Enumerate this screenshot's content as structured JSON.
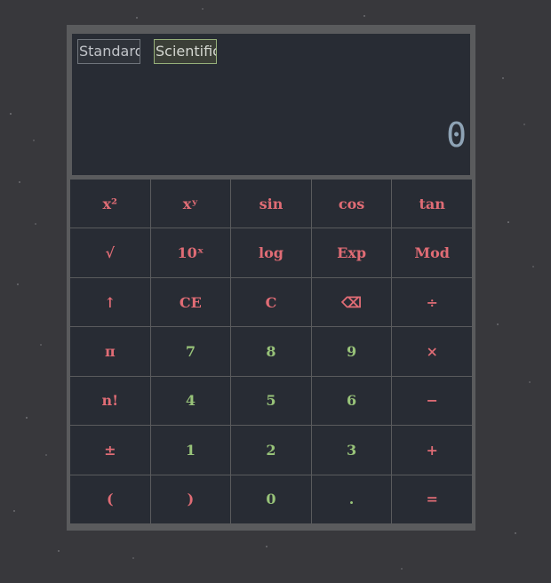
{
  "modes": {
    "standard": "Standard",
    "scientific": "Scientific",
    "active": "Scientific"
  },
  "display": {
    "value": "0"
  },
  "colors": {
    "operator": "#e06c75",
    "digit": "#98c379",
    "panel": "#282c34",
    "frame": "#5a5b5d",
    "desktop": "#38383c"
  },
  "keys": [
    [
      {
        "label": "x²",
        "kind": "op"
      },
      {
        "label": "xʸ",
        "kind": "op"
      },
      {
        "label": "sin",
        "kind": "op"
      },
      {
        "label": "cos",
        "kind": "op"
      },
      {
        "label": "tan",
        "kind": "op"
      }
    ],
    [
      {
        "label": "√",
        "kind": "op"
      },
      {
        "label": "10ˣ",
        "kind": "op"
      },
      {
        "label": "log",
        "kind": "op"
      },
      {
        "label": "Exp",
        "kind": "op"
      },
      {
        "label": "Mod",
        "kind": "op"
      }
    ],
    [
      {
        "label": "↑",
        "kind": "op"
      },
      {
        "label": "CE",
        "kind": "op"
      },
      {
        "label": "C",
        "kind": "op"
      },
      {
        "label": "⌫",
        "kind": "op"
      },
      {
        "label": "÷",
        "kind": "op"
      }
    ],
    [
      {
        "label": "π",
        "kind": "op"
      },
      {
        "label": "7",
        "kind": "num"
      },
      {
        "label": "8",
        "kind": "num"
      },
      {
        "label": "9",
        "kind": "num"
      },
      {
        "label": "×",
        "kind": "op"
      }
    ],
    [
      {
        "label": "n!",
        "kind": "op"
      },
      {
        "label": "4",
        "kind": "num"
      },
      {
        "label": "5",
        "kind": "num"
      },
      {
        "label": "6",
        "kind": "num"
      },
      {
        "label": "−",
        "kind": "op"
      }
    ],
    [
      {
        "label": "±",
        "kind": "op"
      },
      {
        "label": "1",
        "kind": "num"
      },
      {
        "label": "2",
        "kind": "num"
      },
      {
        "label": "3",
        "kind": "num"
      },
      {
        "label": "+",
        "kind": "op"
      }
    ],
    [
      {
        "label": "(",
        "kind": "op"
      },
      {
        "label": ")",
        "kind": "op"
      },
      {
        "label": "0",
        "kind": "num"
      },
      {
        "label": ".",
        "kind": "num"
      },
      {
        "label": "=",
        "kind": "op"
      }
    ]
  ]
}
